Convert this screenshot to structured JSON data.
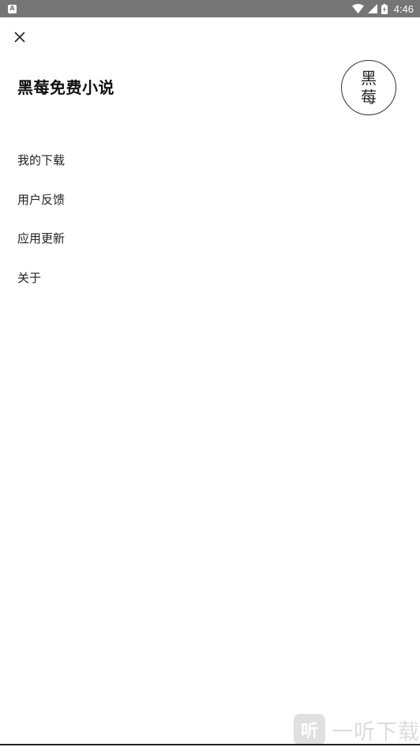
{
  "status_bar": {
    "time": "4:46",
    "notification_icon": "notification-a-icon",
    "icons": [
      "wifi-icon",
      "cell-signal-icon",
      "battery-charging-icon"
    ]
  },
  "close_icon": "close-icon",
  "app": {
    "title": "黑莓免费小说",
    "seal_chars": [
      "黑",
      "莓"
    ]
  },
  "menu": {
    "items": [
      {
        "label": "我的下载"
      },
      {
        "label": "用户反馈"
      },
      {
        "label": "应用更新"
      },
      {
        "label": "关于"
      }
    ]
  },
  "watermark": {
    "badge": "听",
    "text": "一听下载"
  }
}
